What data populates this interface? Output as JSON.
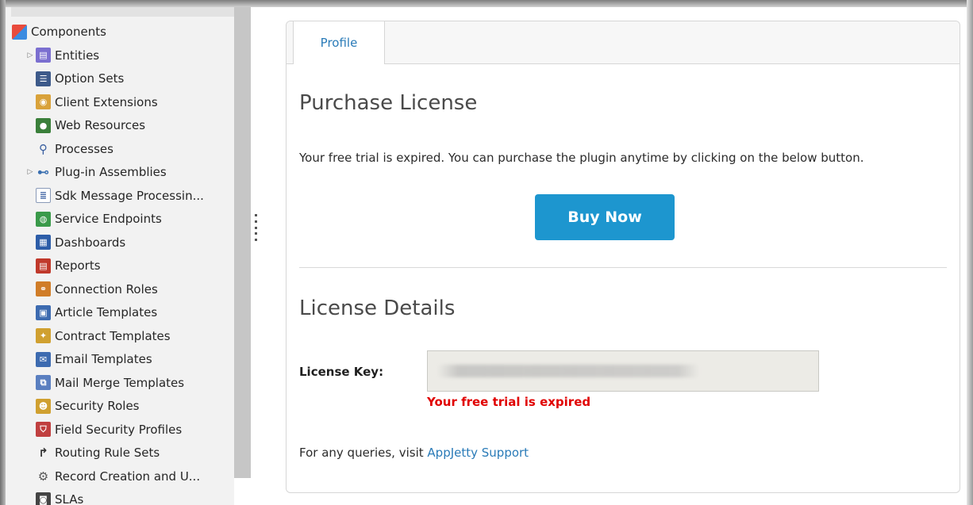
{
  "sidebar": {
    "items": [
      {
        "label": "Components",
        "icon": "components-icon",
        "expander": false,
        "indent": 0
      },
      {
        "label": "Entities",
        "icon": "entities-icon",
        "expander": true,
        "indent": 1
      },
      {
        "label": "Option Sets",
        "icon": "option-sets-icon",
        "expander": false,
        "indent": 1
      },
      {
        "label": "Client Extensions",
        "icon": "client-extensions-icon",
        "expander": false,
        "indent": 1
      },
      {
        "label": "Web Resources",
        "icon": "web-resources-icon",
        "expander": false,
        "indent": 1
      },
      {
        "label": "Processes",
        "icon": "processes-icon",
        "expander": false,
        "indent": 1
      },
      {
        "label": "Plug-in Assemblies",
        "icon": "plugin-assemblies-icon",
        "expander": true,
        "indent": 1
      },
      {
        "label": "Sdk Message Processin...",
        "icon": "sdk-message-icon",
        "expander": false,
        "indent": 1
      },
      {
        "label": "Service Endpoints",
        "icon": "service-endpoints-icon",
        "expander": false,
        "indent": 1
      },
      {
        "label": "Dashboards",
        "icon": "dashboards-icon",
        "expander": false,
        "indent": 1
      },
      {
        "label": "Reports",
        "icon": "reports-icon",
        "expander": false,
        "indent": 1
      },
      {
        "label": "Connection Roles",
        "icon": "connection-roles-icon",
        "expander": false,
        "indent": 1
      },
      {
        "label": "Article Templates",
        "icon": "article-templates-icon",
        "expander": false,
        "indent": 1
      },
      {
        "label": "Contract Templates",
        "icon": "contract-templates-icon",
        "expander": false,
        "indent": 1
      },
      {
        "label": "Email Templates",
        "icon": "email-templates-icon",
        "expander": false,
        "indent": 1
      },
      {
        "label": "Mail Merge Templates",
        "icon": "mail-merge-icon",
        "expander": false,
        "indent": 1
      },
      {
        "label": "Security Roles",
        "icon": "security-roles-icon",
        "expander": false,
        "indent": 1
      },
      {
        "label": "Field Security Profiles",
        "icon": "field-security-icon",
        "expander": false,
        "indent": 1
      },
      {
        "label": "Routing Rule Sets",
        "icon": "routing-rule-icon",
        "expander": false,
        "indent": 1
      },
      {
        "label": "Record Creation and U...",
        "icon": "record-creation-icon",
        "expander": false,
        "indent": 1
      },
      {
        "label": "SLAs",
        "icon": "slas-icon",
        "expander": false,
        "indent": 1
      }
    ]
  },
  "tabs": {
    "profile": "Profile"
  },
  "purchase": {
    "title": "Purchase License",
    "message": "Your free trial is expired. You can purchase the plugin anytime by clicking on the below button.",
    "buy_button": "Buy Now"
  },
  "license": {
    "title": "License Details",
    "key_label": "License Key:",
    "error": "Your free trial is expired",
    "queries_prefix": "For any queries, visit ",
    "support_link": "AppJetty Support"
  },
  "colors": {
    "accent": "#1d96cf",
    "link": "#2a7bb8",
    "error": "#e00000"
  }
}
